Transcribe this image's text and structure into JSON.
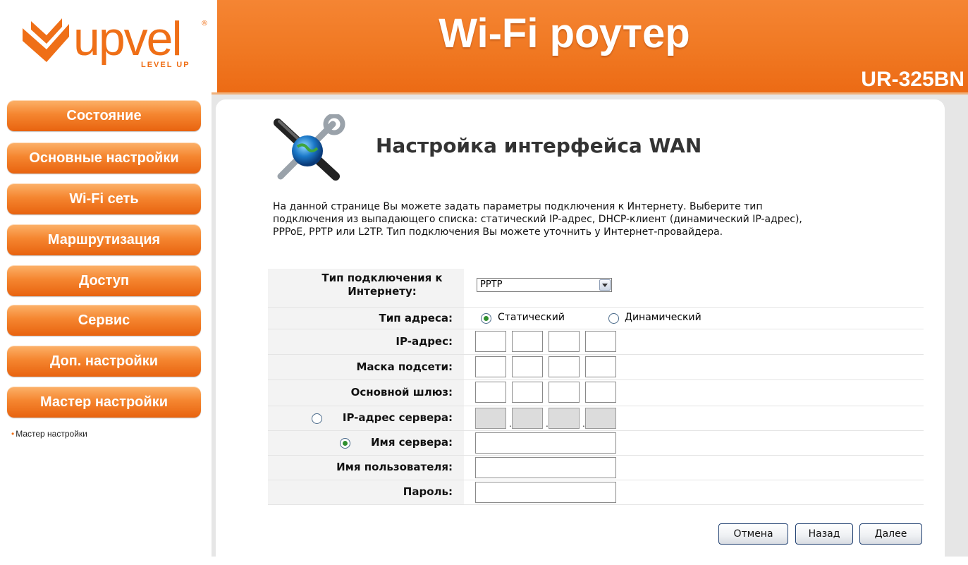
{
  "header": {
    "logo_text": "upvel",
    "logo_tagline": "LEVEL UP",
    "logo_registered": "®",
    "title": "Wi-Fi роутер",
    "model": "UR-325BN",
    "brand_color": "#ef6f17"
  },
  "sidebar": {
    "items": [
      {
        "label": "Состояние"
      },
      {
        "label": "Основные настройки"
      },
      {
        "label": "Wi-Fi сеть"
      },
      {
        "label": "Маршрутизация"
      },
      {
        "label": "Доступ"
      },
      {
        "label": "Сервис"
      },
      {
        "label": "Доп. настройки"
      },
      {
        "label": "Мастер настройки"
      }
    ],
    "subitem": "Мастер настройки"
  },
  "main": {
    "title": "Настройка интерфейса WAN",
    "intro_line1": "На данной странице Вы можете задать параметры подключения к Интернету. Выберите тип",
    "intro_line2": "подключения из выпадающего списка: статический IP-адрес, DHCP-клиент (динамический IP-адрес),",
    "intro_line3": "PPPoE, PPTP или L2TP. Тип подключения Вы можете уточнить у Интернет-провайдера.",
    "form": {
      "connection_type_label_1": "Тип подключения к",
      "connection_type_label_2": "Интернету:",
      "connection_type_value": "PPTP",
      "address_type_label": "Тип адреса:",
      "static_label": "Статический",
      "dynamic_label": "Динамический",
      "ip_label": "IP-адрес:",
      "mask_label": "Маска подсети:",
      "gateway_label": "Основной шлюз:",
      "server_ip_label": "IP-адрес сервера:",
      "server_name_label": "Имя сервера:",
      "username_label": "Имя пользователя:",
      "password_label": "Пароль:"
    },
    "buttons": {
      "cancel": "Отмена",
      "back": "Назад",
      "next": "Далее"
    }
  }
}
